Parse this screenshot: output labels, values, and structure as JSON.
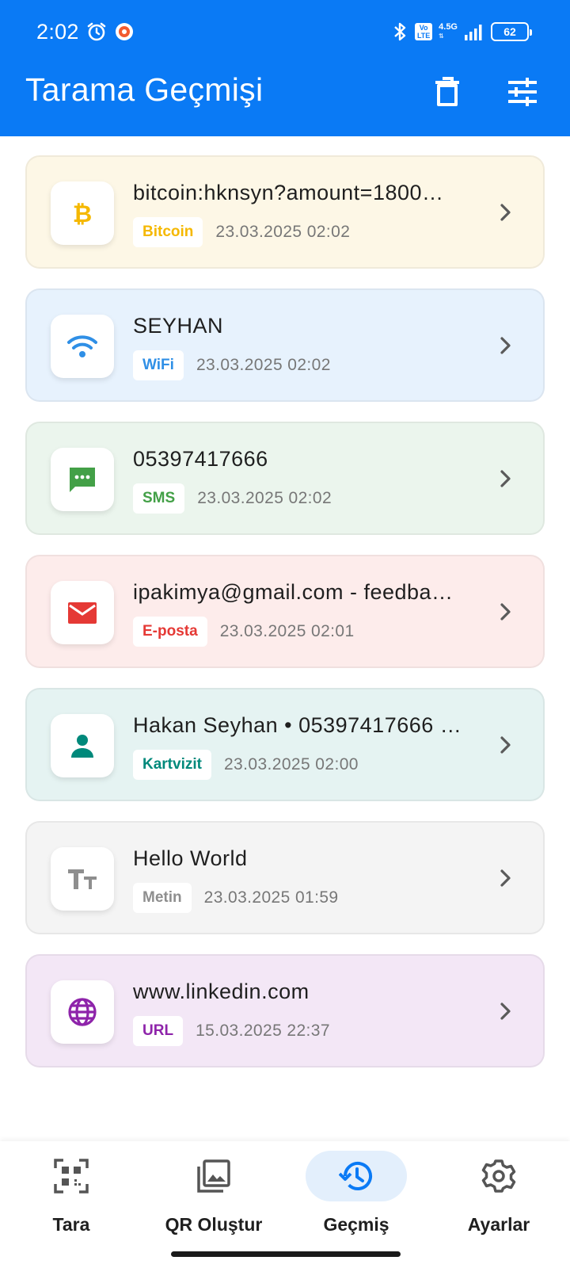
{
  "status_bar": {
    "time": "2:02",
    "network_top": "4.5G",
    "volte": "Vo LTE",
    "battery": "62"
  },
  "app_bar": {
    "title": "Tarama Geçmişi",
    "delete_icon": "trash-icon",
    "filter_icon": "tune-icon"
  },
  "history": [
    {
      "text": "bitcoin:hknsyn?amount=1800…",
      "type": "Bitcoin",
      "date": "23.03.2025 02:02",
      "icon": "bitcoin-icon",
      "accent": "#f5b800",
      "bg": "#fdf7e6"
    },
    {
      "text": "SEYHAN",
      "type": "WiFi",
      "date": "23.03.2025 02:02",
      "icon": "wifi-icon",
      "accent": "#2f8fe6",
      "bg": "#e7f2fd"
    },
    {
      "text": "05397417666",
      "type": "SMS",
      "date": "23.03.2025 02:02",
      "icon": "sms-icon",
      "accent": "#43a047",
      "bg": "#ebf5ed"
    },
    {
      "text": "ipakimya@gmail.com - feedba…",
      "type": "E-posta",
      "date": "23.03.2025 02:01",
      "icon": "mail-icon",
      "accent": "#e53935",
      "bg": "#fdeceb"
    },
    {
      "text": "Hakan Seyhan • 05397417666 …",
      "type": "Kartvizit",
      "date": "23.03.2025 02:00",
      "icon": "contact-icon",
      "accent": "#00897b",
      "bg": "#e5f3f2"
    },
    {
      "text": "Hello World",
      "type": "Metin",
      "date": "23.03.2025 01:59",
      "icon": "text-icon",
      "accent": "#8e8e8e",
      "bg": "#f4f4f4"
    },
    {
      "text": "www.linkedin.com",
      "type": "URL",
      "date": "15.03.2025 22:37",
      "icon": "globe-icon",
      "accent": "#8e24aa",
      "bg": "#f3e7f6"
    }
  ],
  "bottom_nav": {
    "active": "Geçmiş",
    "items": [
      {
        "label": "Tara",
        "icon": "qr-scan-icon"
      },
      {
        "label": "QR Oluştur",
        "icon": "image-icon"
      },
      {
        "label": "Geçmiş",
        "icon": "history-icon"
      },
      {
        "label": "Ayarlar",
        "icon": "settings-icon"
      }
    ]
  },
  "colors": {
    "app_bar": "#0a7af5",
    "nav_active_bg": "#e3effc",
    "nav_active_icon": "#0a7af5"
  }
}
